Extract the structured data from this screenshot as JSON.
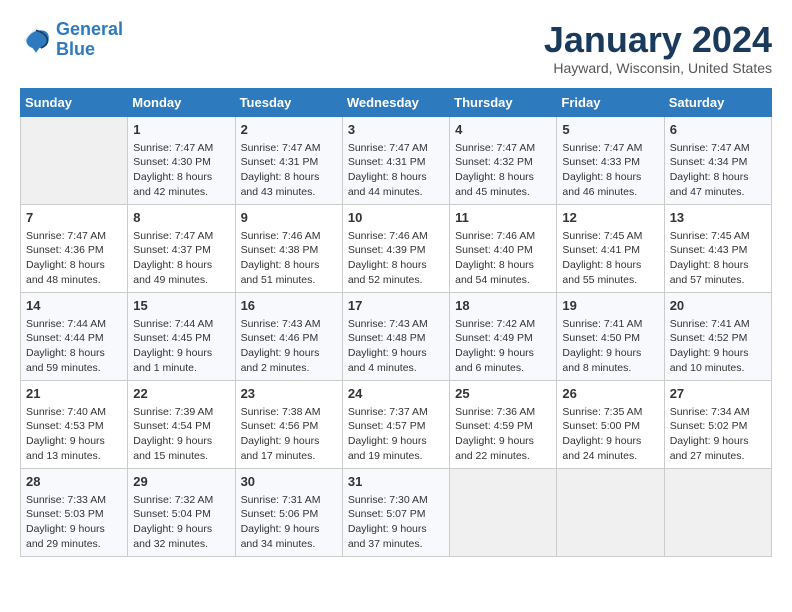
{
  "logo": {
    "line1": "General",
    "line2": "Blue"
  },
  "title": "January 2024",
  "location": "Hayward, Wisconsin, United States",
  "days_header": [
    "Sunday",
    "Monday",
    "Tuesday",
    "Wednesday",
    "Thursday",
    "Friday",
    "Saturday"
  ],
  "weeks": [
    [
      {
        "num": "",
        "info": ""
      },
      {
        "num": "1",
        "info": "Sunrise: 7:47 AM\nSunset: 4:30 PM\nDaylight: 8 hours\nand 42 minutes."
      },
      {
        "num": "2",
        "info": "Sunrise: 7:47 AM\nSunset: 4:31 PM\nDaylight: 8 hours\nand 43 minutes."
      },
      {
        "num": "3",
        "info": "Sunrise: 7:47 AM\nSunset: 4:31 PM\nDaylight: 8 hours\nand 44 minutes."
      },
      {
        "num": "4",
        "info": "Sunrise: 7:47 AM\nSunset: 4:32 PM\nDaylight: 8 hours\nand 45 minutes."
      },
      {
        "num": "5",
        "info": "Sunrise: 7:47 AM\nSunset: 4:33 PM\nDaylight: 8 hours\nand 46 minutes."
      },
      {
        "num": "6",
        "info": "Sunrise: 7:47 AM\nSunset: 4:34 PM\nDaylight: 8 hours\nand 47 minutes."
      }
    ],
    [
      {
        "num": "7",
        "info": "Sunrise: 7:47 AM\nSunset: 4:36 PM\nDaylight: 8 hours\nand 48 minutes."
      },
      {
        "num": "8",
        "info": "Sunrise: 7:47 AM\nSunset: 4:37 PM\nDaylight: 8 hours\nand 49 minutes."
      },
      {
        "num": "9",
        "info": "Sunrise: 7:46 AM\nSunset: 4:38 PM\nDaylight: 8 hours\nand 51 minutes."
      },
      {
        "num": "10",
        "info": "Sunrise: 7:46 AM\nSunset: 4:39 PM\nDaylight: 8 hours\nand 52 minutes."
      },
      {
        "num": "11",
        "info": "Sunrise: 7:46 AM\nSunset: 4:40 PM\nDaylight: 8 hours\nand 54 minutes."
      },
      {
        "num": "12",
        "info": "Sunrise: 7:45 AM\nSunset: 4:41 PM\nDaylight: 8 hours\nand 55 minutes."
      },
      {
        "num": "13",
        "info": "Sunrise: 7:45 AM\nSunset: 4:43 PM\nDaylight: 8 hours\nand 57 minutes."
      }
    ],
    [
      {
        "num": "14",
        "info": "Sunrise: 7:44 AM\nSunset: 4:44 PM\nDaylight: 8 hours\nand 59 minutes."
      },
      {
        "num": "15",
        "info": "Sunrise: 7:44 AM\nSunset: 4:45 PM\nDaylight: 9 hours\nand 1 minute."
      },
      {
        "num": "16",
        "info": "Sunrise: 7:43 AM\nSunset: 4:46 PM\nDaylight: 9 hours\nand 2 minutes."
      },
      {
        "num": "17",
        "info": "Sunrise: 7:43 AM\nSunset: 4:48 PM\nDaylight: 9 hours\nand 4 minutes."
      },
      {
        "num": "18",
        "info": "Sunrise: 7:42 AM\nSunset: 4:49 PM\nDaylight: 9 hours\nand 6 minutes."
      },
      {
        "num": "19",
        "info": "Sunrise: 7:41 AM\nSunset: 4:50 PM\nDaylight: 9 hours\nand 8 minutes."
      },
      {
        "num": "20",
        "info": "Sunrise: 7:41 AM\nSunset: 4:52 PM\nDaylight: 9 hours\nand 10 minutes."
      }
    ],
    [
      {
        "num": "21",
        "info": "Sunrise: 7:40 AM\nSunset: 4:53 PM\nDaylight: 9 hours\nand 13 minutes."
      },
      {
        "num": "22",
        "info": "Sunrise: 7:39 AM\nSunset: 4:54 PM\nDaylight: 9 hours\nand 15 minutes."
      },
      {
        "num": "23",
        "info": "Sunrise: 7:38 AM\nSunset: 4:56 PM\nDaylight: 9 hours\nand 17 minutes."
      },
      {
        "num": "24",
        "info": "Sunrise: 7:37 AM\nSunset: 4:57 PM\nDaylight: 9 hours\nand 19 minutes."
      },
      {
        "num": "25",
        "info": "Sunrise: 7:36 AM\nSunset: 4:59 PM\nDaylight: 9 hours\nand 22 minutes."
      },
      {
        "num": "26",
        "info": "Sunrise: 7:35 AM\nSunset: 5:00 PM\nDaylight: 9 hours\nand 24 minutes."
      },
      {
        "num": "27",
        "info": "Sunrise: 7:34 AM\nSunset: 5:02 PM\nDaylight: 9 hours\nand 27 minutes."
      }
    ],
    [
      {
        "num": "28",
        "info": "Sunrise: 7:33 AM\nSunset: 5:03 PM\nDaylight: 9 hours\nand 29 minutes."
      },
      {
        "num": "29",
        "info": "Sunrise: 7:32 AM\nSunset: 5:04 PM\nDaylight: 9 hours\nand 32 minutes."
      },
      {
        "num": "30",
        "info": "Sunrise: 7:31 AM\nSunset: 5:06 PM\nDaylight: 9 hours\nand 34 minutes."
      },
      {
        "num": "31",
        "info": "Sunrise: 7:30 AM\nSunset: 5:07 PM\nDaylight: 9 hours\nand 37 minutes."
      },
      {
        "num": "",
        "info": ""
      },
      {
        "num": "",
        "info": ""
      },
      {
        "num": "",
        "info": ""
      }
    ]
  ]
}
